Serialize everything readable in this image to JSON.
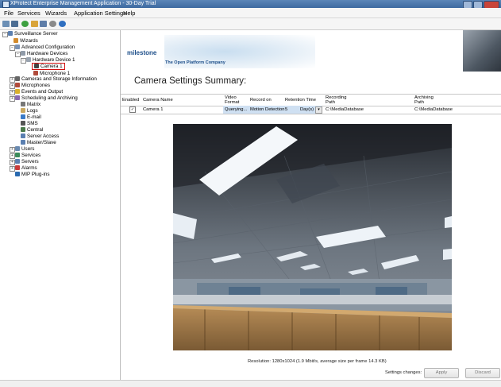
{
  "window": {
    "title": "XProtect Enterprise Management Application - 30-Day Trial"
  },
  "menu": [
    "File",
    "Services",
    "Wizards",
    "Application Settings",
    "Help"
  ],
  "toolbar_icons": [
    "save-icon",
    "network-icon",
    "refresh-icon",
    "chart-icon",
    "database-icon",
    "settings-icon",
    "help-icon"
  ],
  "tree": {
    "items": [
      {
        "label": "Surveillance Server",
        "icon": "server-icon"
      },
      {
        "label": "Wizards",
        "icon": "wizard-icon"
      },
      {
        "label": "Advanced Configuration",
        "icon": "config-icon"
      },
      {
        "label": "Hardware Devices",
        "icon": "hardware-icon"
      },
      {
        "label": "Hardware Device 1",
        "icon": "device-icon"
      },
      {
        "label": "Camera 1",
        "icon": "camera-icon",
        "selected": true
      },
      {
        "label": "Microphone 1",
        "icon": "microphone-icon"
      },
      {
        "label": "Cameras and Storage Information",
        "icon": "camera-storage-icon"
      },
      {
        "label": "Microphones",
        "icon": "microphone-icon"
      },
      {
        "label": "Events and Output",
        "icon": "events-icon"
      },
      {
        "label": "Scheduling and Archiving",
        "icon": "schedule-icon"
      },
      {
        "label": "Matrix",
        "icon": "matrix-icon"
      },
      {
        "label": "Logs",
        "icon": "logs-icon"
      },
      {
        "label": "E-mail",
        "icon": "email-icon"
      },
      {
        "label": "SMS",
        "icon": "sms-icon"
      },
      {
        "label": "Central",
        "icon": "central-icon"
      },
      {
        "label": "Server Access",
        "icon": "server-access-icon"
      },
      {
        "label": "Master/Slave",
        "icon": "master-slave-icon"
      },
      {
        "label": "Users",
        "icon": "users-icon"
      },
      {
        "label": "Services",
        "icon": "services-icon"
      },
      {
        "label": "Servers",
        "icon": "servers-icon"
      },
      {
        "label": "Alarms",
        "icon": "alarms-icon"
      },
      {
        "label": "MIP Plug-ins",
        "icon": "plugin-icon"
      }
    ]
  },
  "banner": {
    "brand": "milestone",
    "tagline": "The Open Platform Company"
  },
  "main": {
    "heading": "Camera Settings Summary:",
    "columns": [
      "Enabled",
      "Camera Name",
      "Video\nFormat",
      "Record on",
      "Retention Time",
      "Recording\nPath",
      "Archiving\nPath"
    ],
    "row": {
      "enabled": "✓",
      "camera_name": "Camera 1",
      "video_format": "Querying...",
      "record_on": "Motion Detection",
      "retention_value": "5",
      "retention_unit": "Day(s)",
      "recording_path": "C:\\MediaDatabase",
      "archiving_path": "C:\\MediaDatabase"
    },
    "resolution": "Resolution: 1280x1024  (1.9 Mbit/s, average size per frame 14.3 KB)",
    "settings_changes_label": "Settings changes:",
    "apply_label": "Apply",
    "discard_label": "Discard"
  },
  "colors": {
    "titlebar": "#3d6aa0",
    "selection_border": "#d01010",
    "row_highlight": "#cfe0f2",
    "brand_blue": "#1e4f8a"
  }
}
